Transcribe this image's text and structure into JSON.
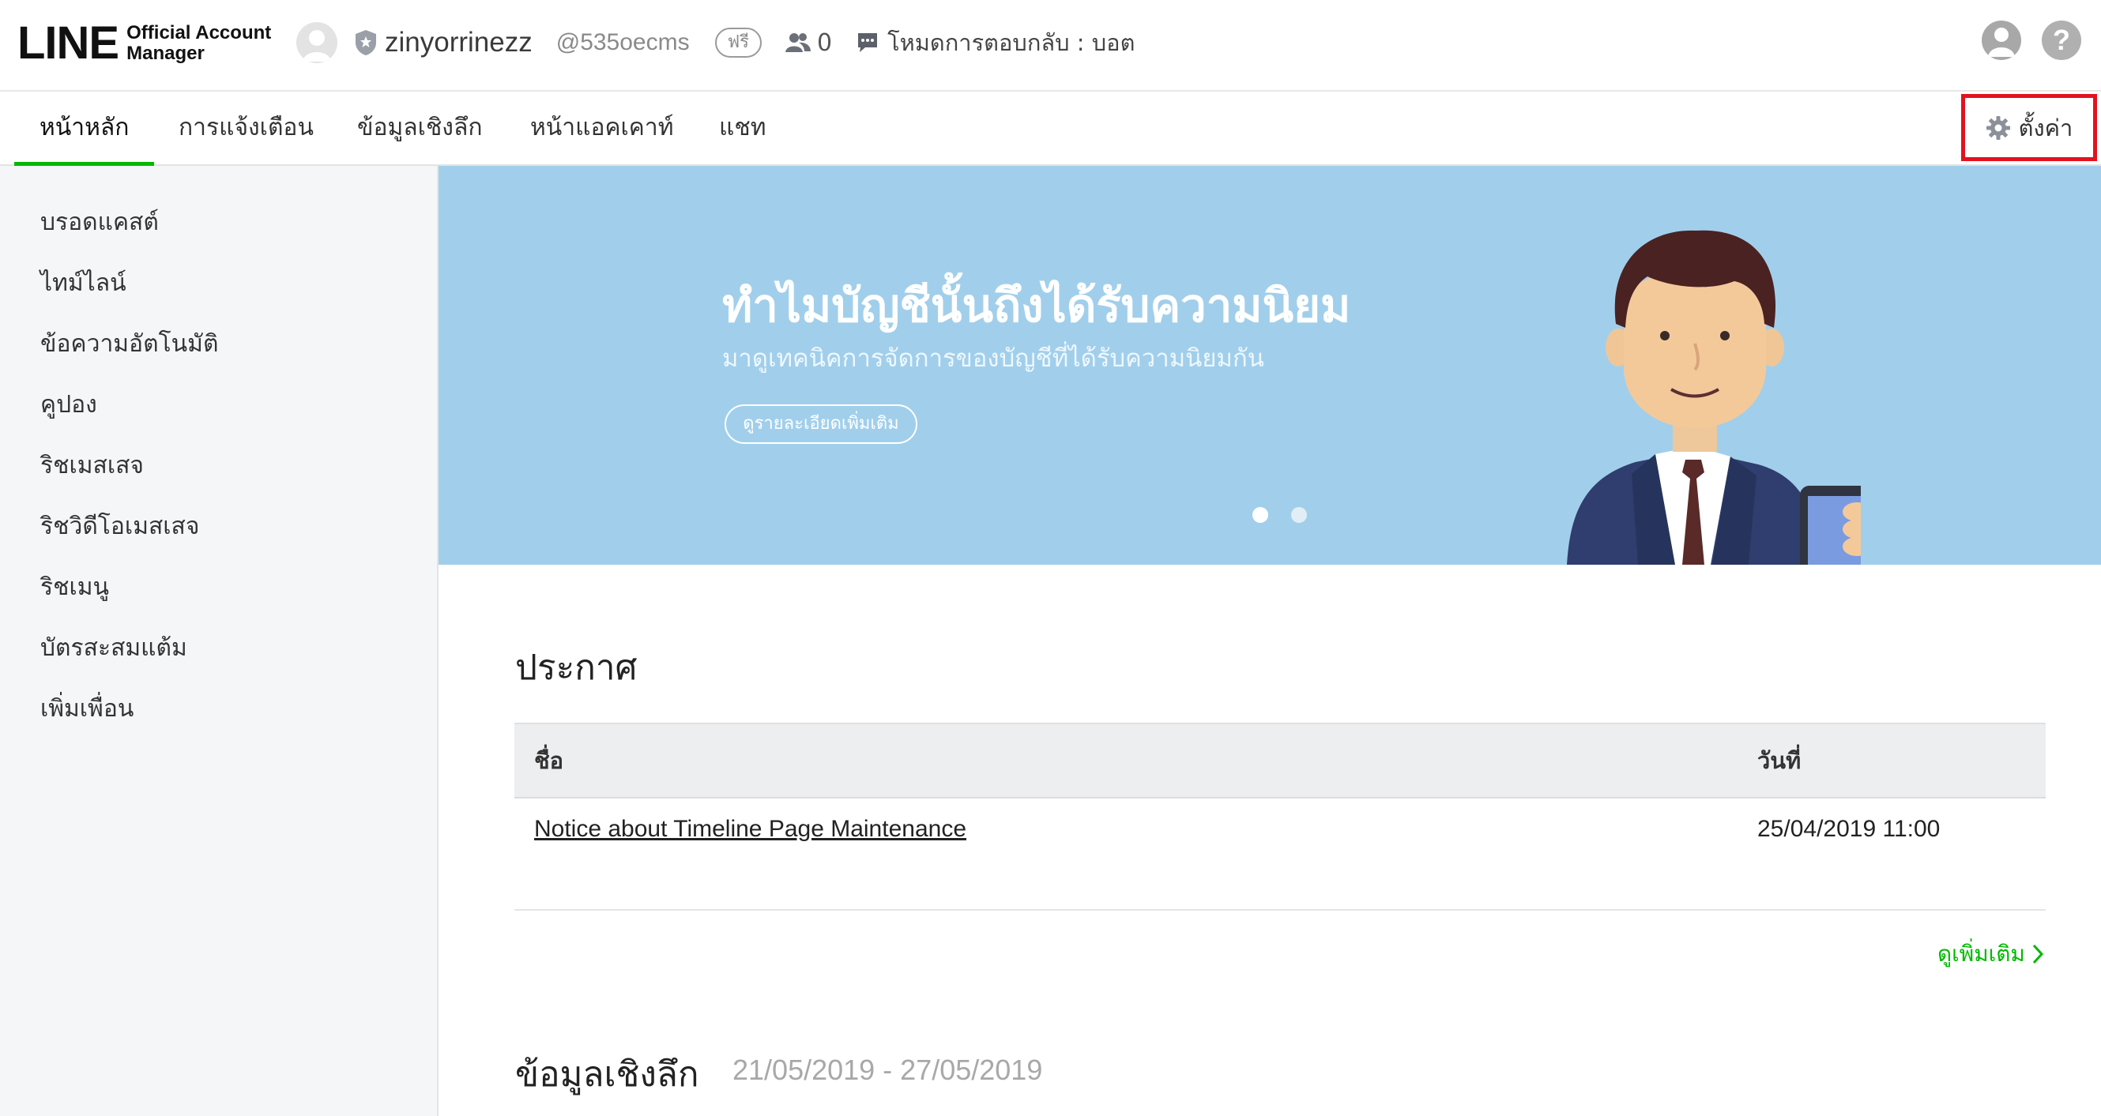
{
  "header": {
    "logo_main": "LINE",
    "logo_sub_1": "Official Account",
    "logo_sub_2": "Manager",
    "account_name": "zinyorrinezz",
    "account_id": "@535oecms",
    "plan_badge": "ฟรี",
    "friend_count": "0",
    "reply_mode": "โหมดการตอบกลับ : บอต",
    "help_label": "?"
  },
  "nav": {
    "tabs": [
      {
        "label": "หน้าหลัก",
        "active": true
      },
      {
        "label": "การแจ้งเตือน",
        "active": false
      },
      {
        "label": "ข้อมูลเชิงลึก",
        "active": false
      },
      {
        "label": "หน้าแอคเคาท์",
        "active": false
      },
      {
        "label": "แชท",
        "active": false
      }
    ],
    "settings_label": "ตั้งค่า"
  },
  "sidebar": {
    "items": [
      {
        "label": "บรอดแคสต์"
      },
      {
        "label": "ไทม์ไลน์"
      },
      {
        "label": "ข้อความอัตโนมัติ"
      },
      {
        "label": "คูปอง"
      },
      {
        "label": "ริชเมสเสจ"
      },
      {
        "label": "ริชวิดีโอเมสเสจ"
      },
      {
        "label": "ริชเมนู"
      },
      {
        "label": "บัตรสะสมแต้ม"
      },
      {
        "label": "เพิ่มเพื่อน"
      }
    ]
  },
  "banner": {
    "title": "ทำไมบัญชีนั้นถึงได้รับความนิยม",
    "subtitle": "มาดูเทคนิคการจัดการของบัญชีที่ได้รับความนิยมกัน",
    "button_label": "ดูรายละเอียดเพิ่มเติม",
    "slides_total": 2,
    "slide_active": 1,
    "colors": {
      "background": "#a1cfeb"
    }
  },
  "announcements": {
    "title": "ประกาศ",
    "columns": [
      "ชื่อ",
      "วันที่"
    ],
    "rows": [
      {
        "name": "Notice about Timeline Page Maintenance",
        "date": "25/04/2019 11:00"
      }
    ],
    "more_label": "ดูเพิ่มเติม"
  },
  "insights": {
    "title": "ข้อมูลเชิงลึก",
    "date_range": "21/05/2019 - 27/05/2019"
  },
  "colors": {
    "accent": "#00b900",
    "highlight_border": "#e3121f"
  }
}
